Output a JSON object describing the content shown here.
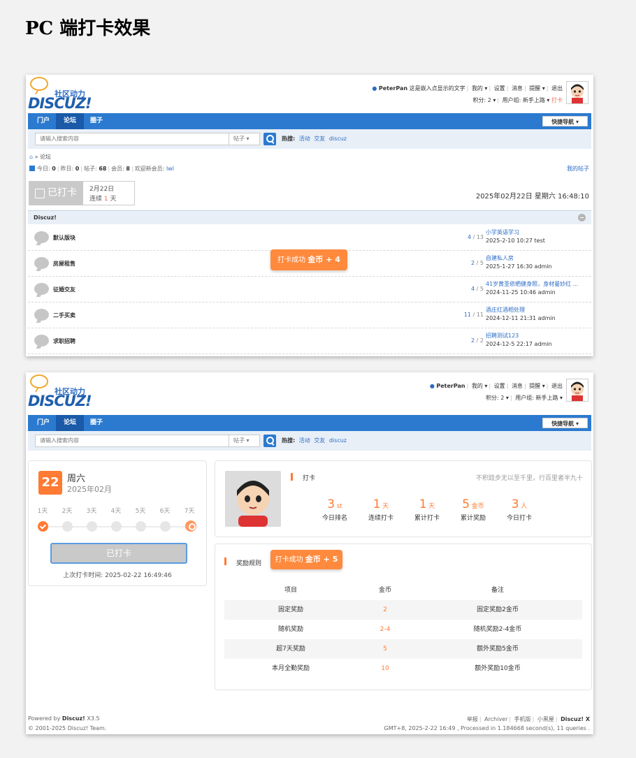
{
  "heading": "PC 端打卡效果",
  "top": {
    "logo_cn": "社区动力",
    "logo_en": "DISCUZ!",
    "user": "PeterPan",
    "user_text": "这是嵌入点显示的文字",
    "links": [
      "我的 ▾",
      "设置",
      "消息",
      "提醒 ▾",
      "退出"
    ],
    "points": "积分: 2 ▾",
    "group": "用户组: 新手上路 ▾",
    "checkin_link": "打卡"
  },
  "nav": {
    "items": [
      "门户",
      "论坛",
      "圈子"
    ],
    "quick": "快捷导航 ▾"
  },
  "search": {
    "placeholder": "请输入搜索内容",
    "select": "帖子 ▾",
    "hot_label": "热搜:",
    "hot": [
      "活动",
      "交友",
      "discuz"
    ]
  },
  "forum": {
    "breadcrumb": "论坛",
    "stats": {
      "today_label": "今日:",
      "today": "0",
      "yesterday_label": "昨日:",
      "yesterday": "0",
      "posts_label": "帖子:",
      "posts": "68",
      "members_label": "会员:",
      "members": "8",
      "welcome_label": "欢迎新会员:",
      "welcome": "lwl"
    },
    "my_posts": "我的帖子",
    "checked_label": "已打卡",
    "check_date": "2月22日",
    "streak_pre": "连续",
    "streak_num": "1",
    "streak_unit": "天",
    "datetime": "2025年02月22日 星期六 16:48:10",
    "group_title": "Discuz!",
    "toast_text": "打卡成功",
    "toast_coin": "金币 + 4",
    "rows": [
      {
        "name": "默认版块",
        "threads": "4",
        "posts": "13",
        "lp_title": "小学英语学习",
        "lp_meta": "2025-2-10 10:27 test"
      },
      {
        "name": "房屋租售",
        "threads": "2",
        "posts": "5",
        "lp_title": "自建私人房",
        "lp_meta": "2025-1-27 16:30 admin"
      },
      {
        "name": "征婚交友",
        "threads": "4",
        "posts": "5",
        "lp_title": "41岁黄圣依晒健身照，身材曼妙红 ...",
        "lp_meta": "2024-11-25 10:46 admin"
      },
      {
        "name": "二手买卖",
        "threads": "11",
        "posts": "11",
        "lp_title": "酒庄红酒相处理",
        "lp_meta": "2024-12-11 21:31 admin"
      },
      {
        "name": "求职招聘",
        "threads": "2",
        "posts": "2",
        "lp_title": "招聘测试123",
        "lp_meta": "2024-12-5 22:17 admin"
      }
    ]
  },
  "checkin": {
    "day": "22",
    "weekday": "周六",
    "year_month": "2025年02月",
    "days": [
      "1天",
      "2天",
      "3天",
      "4天",
      "5天",
      "6天",
      "7天"
    ],
    "button": "已打卡",
    "last_label": "上次打卡时间:",
    "last_time": "2025-02-22 16:49:46",
    "title": "打卡",
    "motto": "不积跬步无以至千里，行百里者半九十",
    "stats": [
      {
        "value": "3",
        "unit": "st",
        "label": "今日排名"
      },
      {
        "value": "1",
        "unit": "天",
        "label": "连续打卡"
      },
      {
        "value": "1",
        "unit": "天",
        "label": "累计打卡"
      },
      {
        "value": "5",
        "unit": "金币",
        "label": "累计奖励"
      },
      {
        "value": "3",
        "unit": "人",
        "label": "今日打卡"
      }
    ],
    "rules_title": "奖励规则",
    "toast_text": "打卡成功",
    "toast_coin": "金币 + 5",
    "table": {
      "headers": [
        "项目",
        "金币",
        "备注"
      ],
      "rows": [
        [
          "固定奖励",
          "2",
          "固定奖励2金币"
        ],
        [
          "随机奖励",
          "2-4",
          "随机奖励2-4金币"
        ],
        [
          "超7天奖励",
          "5",
          "额外奖励5金币"
        ],
        [
          "本月全勤奖励",
          "10",
          "额外奖励10金币"
        ]
      ]
    }
  },
  "footer": {
    "powered_pre": "Powered by",
    "powered_name": "Discuz!",
    "powered_ver": "X3.5",
    "copyright": "© 2001-2025 Discuz! Team.",
    "links": [
      "举报",
      "Archiver",
      "手机版",
      "小黑屋"
    ],
    "brand": "Discuz! X",
    "runtime": "GMT+8, 2025-2-22 16:49 , Processed in 1.184668 second(s), 11 queries ."
  }
}
